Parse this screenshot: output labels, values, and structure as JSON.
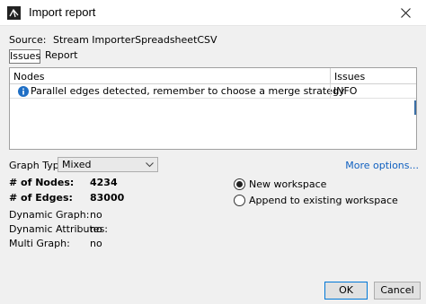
{
  "window": {
    "title": "Import report",
    "icon": "gephi-app-icon",
    "close_icon": "close-icon"
  },
  "source": {
    "label": "Source:",
    "value": "Stream ImporterSpreadsheetCSV"
  },
  "tabs": [
    {
      "label": "Issues",
      "active": true
    },
    {
      "label": "Report",
      "active": false
    }
  ],
  "issues_table": {
    "columns": [
      "Nodes",
      "Issues"
    ],
    "rows": [
      {
        "icon": "info-icon",
        "message": "Parallel edges detected, remember to choose a merge strategy",
        "level": "INFO"
      }
    ]
  },
  "graph_type": {
    "label": "Graph Type:",
    "selected": "Mixed",
    "more_options": "More options..."
  },
  "stats": {
    "nodes_label": "# of Nodes:",
    "nodes_value": "4234",
    "edges_label": "# of Edges:",
    "edges_value": "83000",
    "dynamic_graph_label": "Dynamic Graph:",
    "dynamic_graph_value": "no",
    "dynamic_attributes_label": "Dynamic Attributes:",
    "dynamic_attributes_value": "no",
    "multi_graph_label": "Multi Graph:",
    "multi_graph_value": "no"
  },
  "workspace": {
    "new_label": "New workspace",
    "append_label": "Append to existing workspace",
    "selected": "new"
  },
  "buttons": {
    "ok": "OK",
    "cancel": "Cancel"
  },
  "colors": {
    "link": "#1060c0",
    "info_icon": "#1f6fc5",
    "ok_border": "#0078d7"
  }
}
